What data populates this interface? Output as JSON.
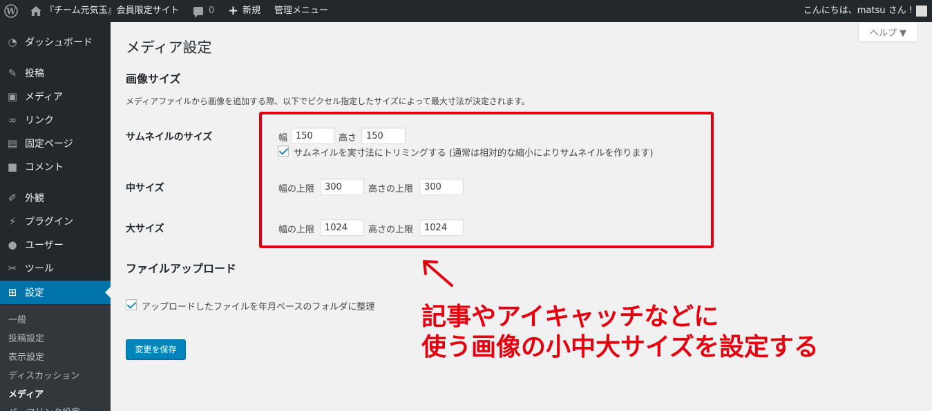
{
  "adminbar": {
    "site_name": "『チーム元気玉』会員限定サイト",
    "comments_count": "0",
    "new_label": "新規",
    "admin_menu_label": "管理メニュー",
    "greeting": "こんにちは、matsu さん !"
  },
  "sidebar": {
    "items": [
      {
        "label": "ダッシュボード",
        "icon": "dashboard-icon"
      },
      {
        "label": "投稿",
        "icon": "pin-icon"
      },
      {
        "label": "メディア",
        "icon": "media-icon"
      },
      {
        "label": "リンク",
        "icon": "link-icon"
      },
      {
        "label": "固定ページ",
        "icon": "page-icon"
      },
      {
        "label": "コメント",
        "icon": "comment-icon"
      },
      {
        "label": "外観",
        "icon": "brush-icon"
      },
      {
        "label": "プラグイン",
        "icon": "plugin-icon"
      },
      {
        "label": "ユーザー",
        "icon": "user-icon"
      },
      {
        "label": "ツール",
        "icon": "wrench-icon"
      },
      {
        "label": "設定",
        "icon": "settings-icon",
        "active": true
      }
    ],
    "submenu": [
      "一般",
      "投稿設定",
      "表示設定",
      "ディスカッション",
      "メディア",
      "パーマリンク設定"
    ],
    "current_submenu": "メディア"
  },
  "help_tab": {
    "label": "ヘルプ ▼"
  },
  "main": {
    "page_title": "メディア設定",
    "image_sizes": {
      "title": "画像サイズ",
      "description": "メディアファイルから画像を追加する際、以下でピクセル指定したサイズによって最大寸法が決定されます。",
      "thumbnail": {
        "label": "サムネイルのサイズ",
        "width_label": "幅",
        "width": "150",
        "height_label": "高さ",
        "height": "150",
        "crop_label": "サムネイルを実寸法にトリミングする (通常は相対的な縮小によりサムネイルを作ります)",
        "crop_checked": true
      },
      "medium": {
        "label": "中サイズ",
        "width_label": "幅の上限",
        "width": "300",
        "height_label": "高さの上限",
        "height": "300"
      },
      "large": {
        "label": "大サイズ",
        "width_label": "幅の上限",
        "width": "1024",
        "height_label": "高さの上限",
        "height": "1024"
      }
    },
    "uploads": {
      "title": "ファイルアップロード",
      "organize_label": "アップロードしたファイルを年月ベースのフォルダに整理",
      "organize_checked": true
    },
    "save_label": "変更を保存"
  },
  "annotation": {
    "line1": "記事やアイキャッチなどに",
    "line2": "使う画像の小中大サイズを設定する",
    "color": "#e5000f"
  }
}
